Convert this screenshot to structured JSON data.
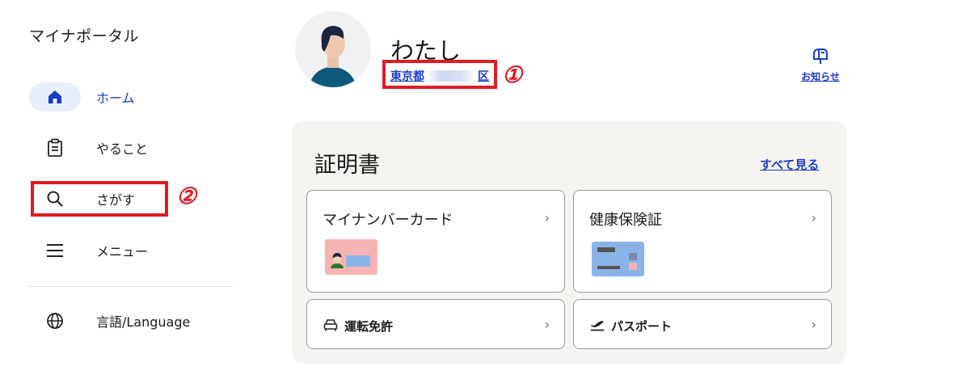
{
  "app": {
    "title": "マイナポータル"
  },
  "sidebar": {
    "items": [
      {
        "label": "ホーム",
        "icon": "home-icon"
      },
      {
        "label": "やること",
        "icon": "clipboard-icon"
      },
      {
        "label": "さがす",
        "icon": "search-icon"
      },
      {
        "label": "メニュー",
        "icon": "menu-icon"
      },
      {
        "label": "言語/Language",
        "icon": "globe-icon"
      }
    ]
  },
  "user": {
    "name": "わたし",
    "address_prefix": "東京都",
    "address_suffix": "区"
  },
  "header": {
    "notice_label": "お知らせ",
    "notice_icon": "mailbox-icon"
  },
  "certificates": {
    "title": "証明書",
    "see_all": "すべて見る",
    "cards": [
      {
        "label": "マイナンバーカード"
      },
      {
        "label": "健康保険証"
      },
      {
        "label": "運転免許",
        "icon": "car-icon"
      },
      {
        "label": "パスポート",
        "icon": "airplane-icon"
      }
    ]
  },
  "annotations": {
    "one": "①",
    "two": "②"
  },
  "colors": {
    "accent": "#1a3cc8",
    "annotation": "#e11b22",
    "panel": "#f5f4f1",
    "mynumber_card": "#f6b3b3",
    "insurance_card": "#8ab4e8"
  }
}
